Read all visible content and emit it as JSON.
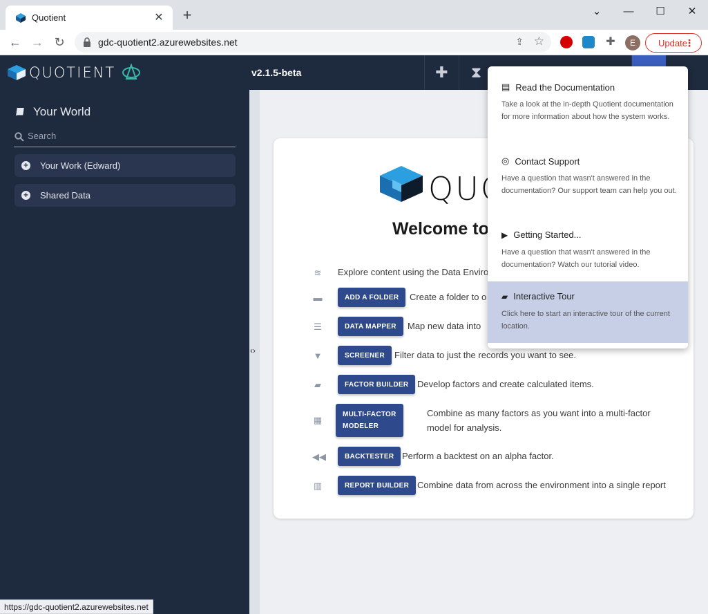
{
  "browser": {
    "tab_title": "Quotient",
    "url": "gdc-quotient2.azurewebsites.net",
    "update_label": "Update",
    "profile_initial": "E",
    "status_url": "https://gdc-quotient2.azurewebsites.net"
  },
  "header": {
    "logo_text": "QUOTIENT",
    "version": "v2.1.5-beta"
  },
  "sidebar": {
    "title": "Your World",
    "search_placeholder": "Search",
    "items": [
      {
        "label": "Your Work (Edward)"
      },
      {
        "label": "Shared Data"
      }
    ]
  },
  "welcome": {
    "logo_text": "QUO",
    "heading": "Welcome to",
    "explore_text": "Explore content using the Data Enviro",
    "features": [
      {
        "button": "ADD A FOLDER",
        "text": "Create a folder to o",
        "icon": "folder-icon"
      },
      {
        "button": "DATA MAPPER",
        "text": "Map new data into",
        "icon": "list-icon"
      },
      {
        "button": "SCREENER",
        "text": "Filter data to just the records you want to see.",
        "icon": "filter-icon"
      },
      {
        "button": "FACTOR BUILDER",
        "text": "Develop factors and create calculated items.",
        "icon": "book-icon"
      },
      {
        "button_line1": "MULTI-FACTOR",
        "button_line2": "MODELER",
        "text_line1": "Combine as many factors as you want into a multi-factor",
        "text_line2": "model for analysis.",
        "icon": "calculator-icon"
      },
      {
        "button": "BACKTESTER",
        "text": "Perform a backtest on an alpha factor.",
        "icon": "rewind-icon"
      },
      {
        "button": "REPORT BUILDER",
        "text": "Combine data from across the environment into a single report",
        "icon": "bar-chart-icon"
      }
    ]
  },
  "help_menu": {
    "items": [
      {
        "title": "Read the Documentation",
        "desc": "Take a look at the in-depth Quotient documentation for more information about how the system works."
      },
      {
        "title": "Contact Support",
        "desc": "Have a question that wasn't answered in the documentation? Our support team can help you out."
      },
      {
        "title": "Getting Started...",
        "desc": "Have a question that wasn't answered in the documentation? Watch our tutorial video."
      },
      {
        "title": "Interactive Tour",
        "desc": "Click here to start an interactive tour of the current location."
      }
    ]
  },
  "colors": {
    "header_bg": "#1e2a3d",
    "button_bg": "#2f4a8c",
    "menu_highlight": "#c6cfe6",
    "update_red": "#d93025"
  }
}
